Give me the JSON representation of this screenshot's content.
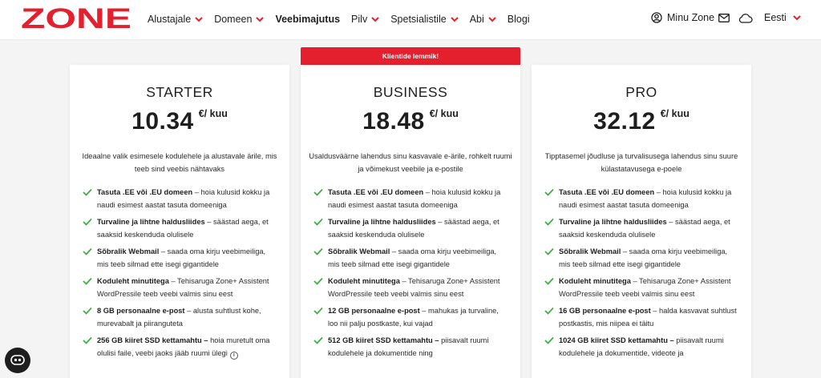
{
  "brand": {
    "logo_text": "ZONE",
    "accent": "#e4202e",
    "check_color": "#3cb043"
  },
  "nav": {
    "items": [
      {
        "label": "Alustajale",
        "dropdown": true,
        "bold": false
      },
      {
        "label": "Domeen",
        "dropdown": true,
        "bold": false
      },
      {
        "label": "Veebimajutus",
        "dropdown": false,
        "bold": true
      },
      {
        "label": "Pilv",
        "dropdown": true,
        "bold": false
      },
      {
        "label": "Spetsialistile",
        "dropdown": true,
        "bold": false
      },
      {
        "label": "Abi",
        "dropdown": true,
        "bold": false
      },
      {
        "label": "Blogi",
        "dropdown": false,
        "bold": false
      }
    ],
    "account_label": "Minu Zone",
    "language_label": "Eesti"
  },
  "ribbon": {
    "label": "Klientide lemmik!"
  },
  "plans": [
    {
      "name": "STARTER",
      "price": "10.34",
      "unit": "€/ kuu",
      "description": "Ideaalne valik esimesele kodulehele ja alustavale ärile, mis teeb sind veebis nähtavaks",
      "features": [
        {
          "bold": "Tasuta .EE või .EU domeen",
          "text": " – hoia kulusid kokku ja naudi esimest aastat tasuta domeeniga"
        },
        {
          "bold": "Turvaline ja lihtne haldusliides",
          "text": " – säästad aega, et saaksid keskenduda olulisele"
        },
        {
          "bold": "Sõbralik Webmail",
          "text": " – saada oma kirju veebimeiliga, mis teeb silmad ette isegi gigantidele"
        },
        {
          "bold": "Koduleht minutitega",
          "text": " – Tehisaruga Zone+ Assistent WordPressile teeb veebi valmis sinu eest"
        },
        {
          "bold": "8 GB personaalne e-post",
          "text": " – alusta suhtlust kohe, murevabalt ja piiranguteta"
        },
        {
          "bold": "256 GB kiiret SSD kettamahtu –",
          "text": " hoia muretult oma olulisi faile, veebi jaoks jääb ruumi ülegi"
        }
      ]
    },
    {
      "name": "BUSINESS",
      "price": "18.48",
      "unit": "€/ kuu",
      "description": "Usaldusväärne lahendus sinu kasvavale e-ärile, rohkelt ruumi ja võimekust veebile ja e-postile",
      "features": [
        {
          "bold": "Tasuta .EE või .EU domeen",
          "text": " – hoia kulusid kokku ja naudi esimest aastat tasuta domeeniga"
        },
        {
          "bold": "Turvaline ja lihtne haldusliides",
          "text": " – säästad aega, et saaksid keskenduda olulisele"
        },
        {
          "bold": "Sõbralik Webmail",
          "text": " – saada oma kirju veebimeiliga, mis teeb silmad ette isegi gigantidele"
        },
        {
          "bold": "Koduleht minutitega",
          "text": " – Tehisaruga Zone+ Assistent WordPressile teeb veebi valmis sinu eest"
        },
        {
          "bold": "12 GB personaalne e-post",
          "text": " – mahukas ja turvaline, loo nii palju postkaste, kui vajad"
        },
        {
          "bold": "512 GB kiiret SSD kettamahtu –",
          "text": " piisavalt ruumi kodulehele ja dokumentide ning"
        }
      ]
    },
    {
      "name": "PRO",
      "price": "32.12",
      "unit": "€/ kuu",
      "description": "Tipptasemel jõudluse ja turvalisusega lahendus sinu suure külastatavusega e-poele",
      "features": [
        {
          "bold": "Tasuta .EE või .EU domeen",
          "text": " – hoia kulusid kokku ja naudi esimest aastat tasuta domeeniga"
        },
        {
          "bold": "Turvaline ja lihtne haldusliides",
          "text": " – säästad aega, et saaksid keskenduda olulisele"
        },
        {
          "bold": "Sõbralik Webmail",
          "text": " – saada oma kirju veebimeiliga, mis teeb silmad ette isegi gigantidele"
        },
        {
          "bold": "Koduleht minutitega",
          "text": " – Tehisaruga Zone+ Assistent WordPressile teeb veebi valmis sinu eest"
        },
        {
          "bold": "16 GB personaalne e-post",
          "text": " – halda kasvavat suhtlust postkastis, mis niipea ei täitu"
        },
        {
          "bold": "1024 GB kiiret SSD kettamahtu –",
          "text": " piisavalt ruumi kodulehele ja dokumentide, videote ja"
        }
      ]
    }
  ]
}
